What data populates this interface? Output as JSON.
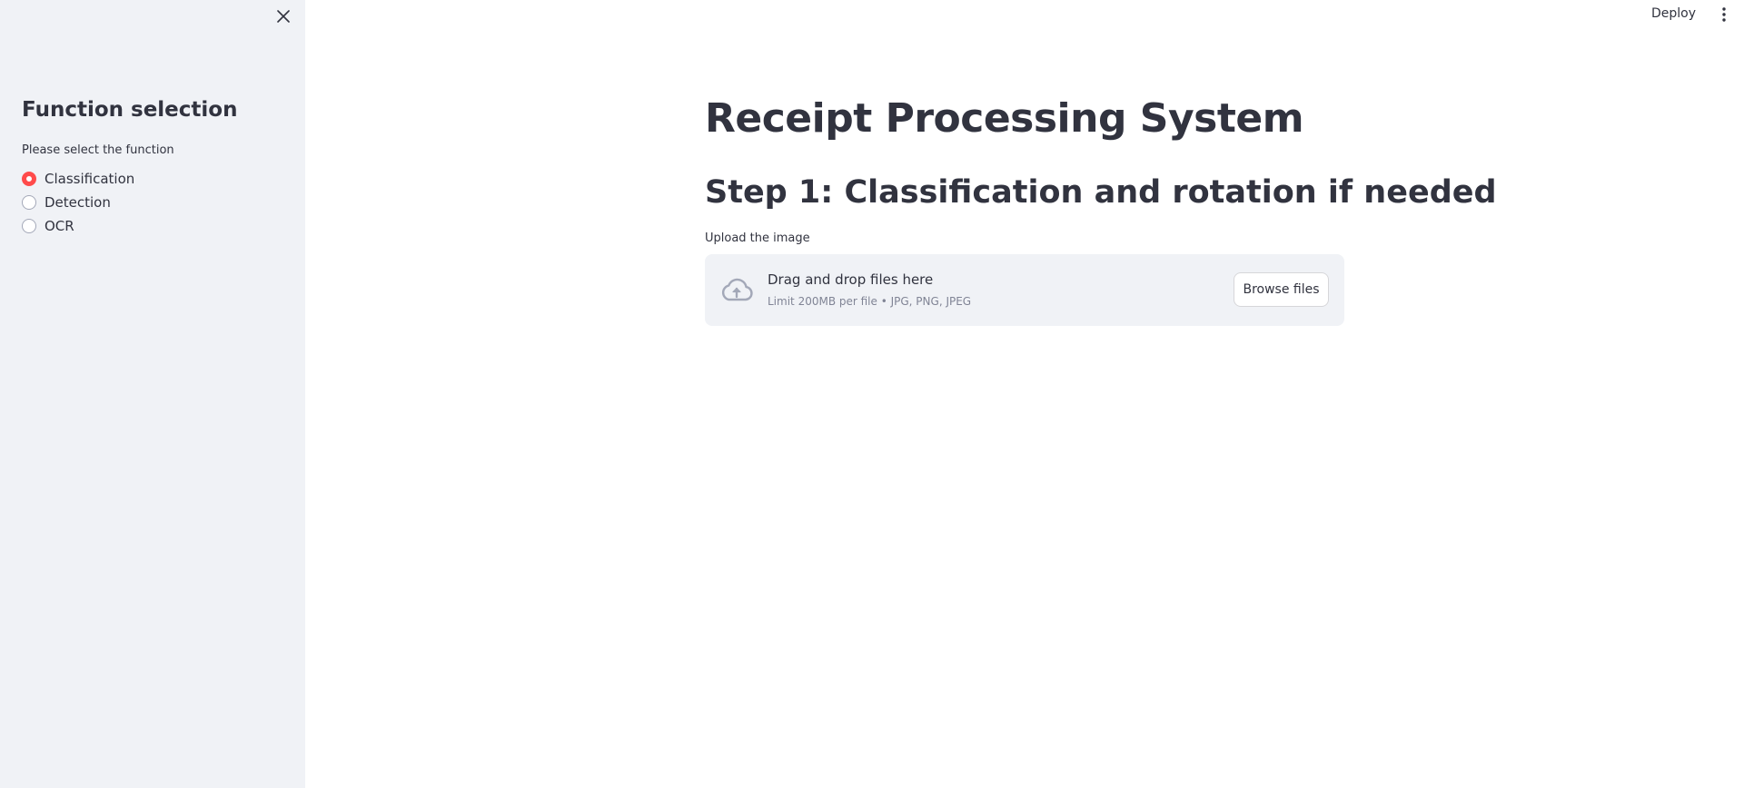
{
  "sidebar": {
    "close_icon": "close-icon",
    "title": "Function selection",
    "radio_label": "Please select the function",
    "options": [
      {
        "label": "Classification",
        "selected": true
      },
      {
        "label": "Detection",
        "selected": false
      },
      {
        "label": "OCR",
        "selected": false
      }
    ]
  },
  "header": {
    "deploy_label": "Deploy",
    "menu_icon": "vertical-dots-icon"
  },
  "main": {
    "title": "Receipt Processing System",
    "step_title": "Step 1: Classification and rotation if needed",
    "uploader": {
      "label": "Upload the image",
      "icon": "cloud-upload-icon",
      "drop_text": "Drag and drop files here",
      "limit_text": "Limit 200MB per file • JPG, PNG, JPEG",
      "browse_label": "Browse files"
    }
  },
  "colors": {
    "sidebar_bg": "#f0f2f6",
    "accent": "#ff4b4b",
    "text": "#31333f",
    "muted_text": "#808495"
  }
}
